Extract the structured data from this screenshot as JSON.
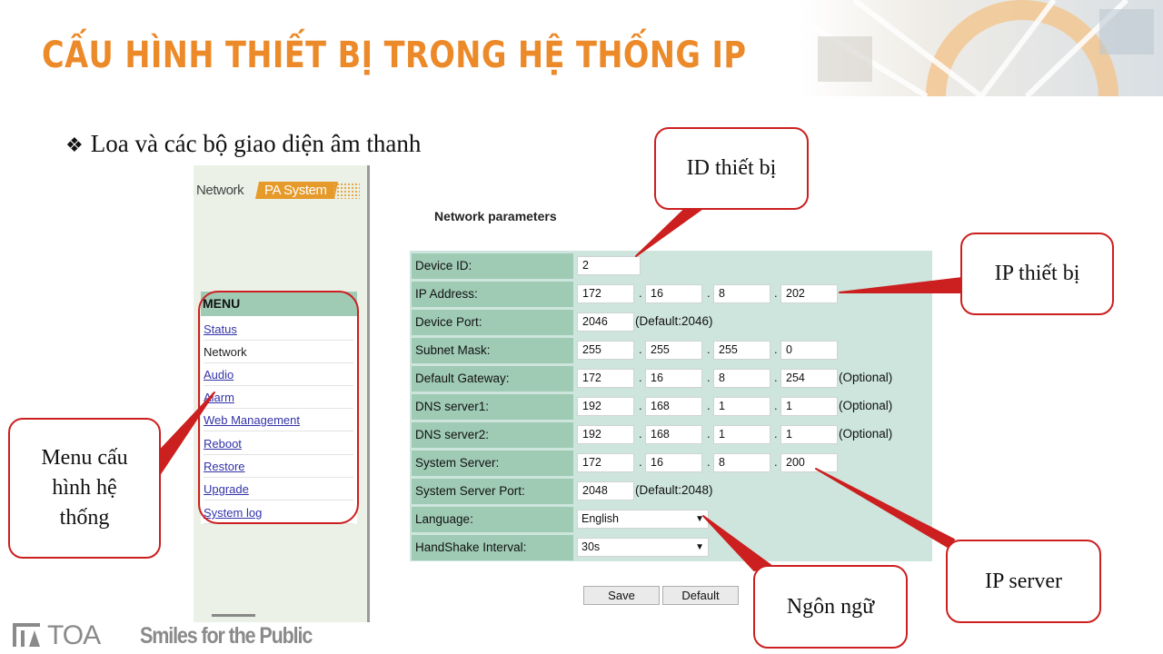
{
  "slide": {
    "title": "CẤU HÌNH THIẾT BỊ TRONG HỆ THỐNG IP",
    "bullet_glyph": "❖",
    "bullet": "Loa và các bộ giao diện âm thanh"
  },
  "webui": {
    "logo_left": "Network",
    "logo_right": "PA System",
    "menu_title": "MENU",
    "menu_items": [
      {
        "label": "Status"
      },
      {
        "label": "Network"
      },
      {
        "label": "Audio"
      },
      {
        "label": "Alarm"
      },
      {
        "label": "Web Management"
      },
      {
        "label": "Reboot"
      },
      {
        "label": "Restore"
      },
      {
        "label": "Upgrade"
      },
      {
        "label": "System log"
      }
    ],
    "active_item": "Network"
  },
  "form": {
    "title": "Network parameters",
    "device_id": {
      "label": "Device ID:",
      "value": "2"
    },
    "ip_address": {
      "label": "IP Address:",
      "octets": [
        "172",
        "16",
        "8",
        "202"
      ]
    },
    "device_port": {
      "label": "Device Port:",
      "value": "2046",
      "note": "(Default:2046)"
    },
    "subnet_mask": {
      "label": "Subnet Mask:",
      "octets": [
        "255",
        "255",
        "255",
        "0"
      ]
    },
    "default_gateway": {
      "label": "Default Gateway:",
      "octets": [
        "172",
        "16",
        "8",
        "254"
      ],
      "note": "(Optional)"
    },
    "dns1": {
      "label": "DNS server1:",
      "octets": [
        "192",
        "168",
        "1",
        "1"
      ],
      "note": "(Optional)"
    },
    "dns2": {
      "label": "DNS server2:",
      "octets": [
        "192",
        "168",
        "1",
        "1"
      ],
      "note": "(Optional)"
    },
    "system_server": {
      "label": "System Server:",
      "octets": [
        "172",
        "16",
        "8",
        "200"
      ]
    },
    "system_server_port": {
      "label": "System Server Port:",
      "value": "2048",
      "note": "(Default:2048)"
    },
    "language": {
      "label": "Language:",
      "value": "English"
    },
    "handshake": {
      "label": "HandShake Interval:",
      "value": "30s"
    },
    "dot": ".",
    "save_label": "Save",
    "default_label": "Default"
  },
  "callouts": {
    "device_id": "ID thiết bị",
    "ip_device": "IP thiết bị",
    "menu": "Menu cấu hình hệ thống",
    "language": "Ngôn ngữ",
    "ip_server": "IP server"
  },
  "footer": {
    "brand": "TOA",
    "slogan": "Smiles for the Public"
  },
  "colors": {
    "title_orange": "#ec8a2a",
    "label_green": "#9fcbb5",
    "form_bg": "#cde5dd",
    "callout_red": "#cc1f1f",
    "link_blue": "#3333aa"
  }
}
